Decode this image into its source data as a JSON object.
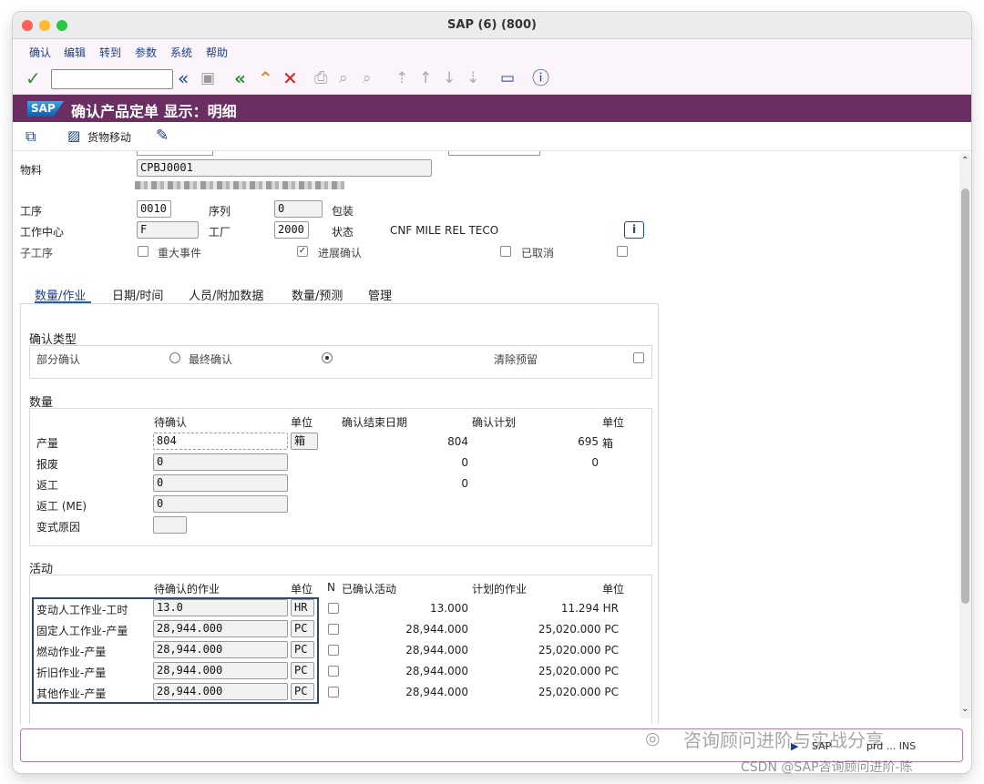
{
  "window": {
    "title": "SAP (6) (800)"
  },
  "menu": [
    "确认",
    "编辑",
    "转到",
    "参数",
    "系统",
    "帮助"
  ],
  "header": {
    "title": "确认产品定单 显示：明细",
    "logo": "SAP"
  },
  "app_toolbar": {
    "goods_movement": "货物移动"
  },
  "fields": {
    "material_label": "物料",
    "material_value": "CPBJ0001",
    "operation_label": "工序",
    "operation_value": "0010",
    "sequence_label": "序列",
    "sequence_value": "0",
    "packaging_label": "包装",
    "workcenter_label": "工作中心",
    "workcenter_value": "F",
    "plant_label": "工厂",
    "plant_value": "2000",
    "status_label": "状态",
    "status_value": "CNF  MILE REL  TECO",
    "suboperation_label": "子工序",
    "major_event_label": "重大事件",
    "progress_confirm_label": "进展确认",
    "cancelled_label": "已取消"
  },
  "tabs": [
    "数量/作业",
    "日期/时间",
    "人员/附加数据",
    "数量/预测",
    "管理"
  ],
  "confirm_type": {
    "title": "确认类型",
    "partial": "部分确认",
    "final": "最终确认",
    "clear_reservation": "清除预留"
  },
  "quantity": {
    "title": "数量",
    "col_pending": "待确认",
    "col_unit": "单位",
    "col_end_date": "确认结束日期",
    "col_plan": "确认计划",
    "col_unit2": "单位",
    "rows": [
      {
        "label": "产量",
        "value": "804",
        "unit": "箱",
        "confirmed": "804",
        "plan": "695",
        "plan_unit": "箱"
      },
      {
        "label": "报废",
        "value": "0",
        "unit": "",
        "confirmed": "0",
        "plan": "0",
        "plan_unit": ""
      },
      {
        "label": "返工",
        "value": "0",
        "unit": "",
        "confirmed": "0",
        "plan": "",
        "plan_unit": ""
      },
      {
        "label": "返工 (ME)",
        "value": "0",
        "unit": "",
        "confirmed": "",
        "plan": "",
        "plan_unit": ""
      },
      {
        "label": "变式原因",
        "value": "",
        "unit": "",
        "confirmed": "",
        "plan": "",
        "plan_unit": ""
      }
    ]
  },
  "activity": {
    "title": "活动",
    "col_pending": "待确认的作业",
    "col_unit": "单位",
    "col_n": "N",
    "col_confirmed": "已确认活动",
    "col_plan": "计划的作业",
    "col_unit2": "单位",
    "rows": [
      {
        "label": "变动人工作业-工时",
        "value": "13.0",
        "unit": "HR",
        "confirmed": "13.000",
        "plan": "11.294 HR"
      },
      {
        "label": "固定人工作业-产量",
        "value": "28,944.000",
        "unit": "PC",
        "confirmed": "28,944.000",
        "plan": "25,020.000 PC"
      },
      {
        "label": "燃动作业-产量",
        "value": "28,944.000",
        "unit": "PC",
        "confirmed": "28,944.000",
        "plan": "25,020.000 PC"
      },
      {
        "label": "折旧作业-产量",
        "value": "28,944.000",
        "unit": "PC",
        "confirmed": "28,944.000",
        "plan": "25,020.000 PC"
      },
      {
        "label": "其他作业-产量",
        "value": "28,944.000",
        "unit": "PC",
        "confirmed": "28,944.000",
        "plan": "25,020.000 PC"
      }
    ]
  },
  "statusbar": {
    "sap": "SAP",
    "prd": "prd ... INS"
  },
  "watermark": {
    "line1": "咨询顾问进阶与实战分享",
    "line2": "CSDN @SAP咨询顾问进阶-陈"
  },
  "colors": {
    "header_bg": "#6b2e63",
    "menu_text": "#1a3f88",
    "highlight_border": "#2c4a6e"
  }
}
